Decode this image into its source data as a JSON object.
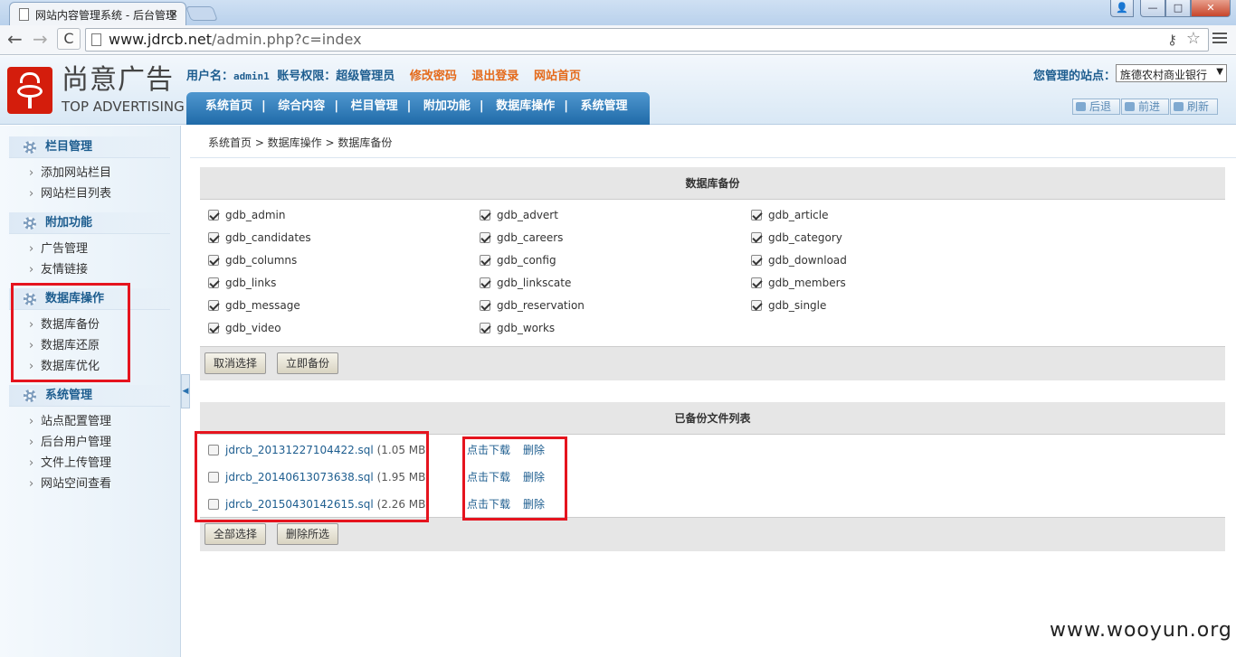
{
  "browser": {
    "tab_title": "网站内容管理系统 - 后台管理",
    "tab_close": "×",
    "url_host": "www.jdrcb.net",
    "url_path": "/admin.php?c=index",
    "win_user": "👤",
    "win_min": "—",
    "win_max": "□",
    "win_close": "✕",
    "back": "←",
    "forward": "→",
    "reload": "C",
    "key_icon": "⚷",
    "star": "☆"
  },
  "header": {
    "logo_cn": "尚意广告",
    "logo_en": "TOP ADVERTISING",
    "username_label": "用户名：",
    "username": "admin1",
    "role": "账号权限：超级管理员",
    "change_pwd": "修改密码",
    "logout": "退出登录",
    "site_home": "网站首页",
    "site_label": "您管理的站点：",
    "site_value": "旌德农村商业银行",
    "select_arrow": "▼",
    "nav": [
      "系统首页",
      "综合内容",
      "栏目管理",
      "附加功能",
      "数据库操作",
      "系统管理"
    ],
    "nav_sep": "|",
    "history": [
      "后退",
      "前进",
      "刷新"
    ]
  },
  "sidebar": {
    "groups": [
      {
        "title": "栏目管理",
        "items": [
          "添加网站栏目",
          "网站栏目列表"
        ]
      },
      {
        "title": "附加功能",
        "items": [
          "广告管理",
          "友情链接"
        ]
      },
      {
        "title": "数据库操作",
        "items": [
          "数据库备份",
          "数据库还原",
          "数据库优化"
        ]
      },
      {
        "title": "系统管理",
        "items": [
          "站点配置管理",
          "后台用户管理",
          "文件上传管理",
          "网站空间查看"
        ]
      }
    ],
    "collapse_glyph": "◀"
  },
  "breadcrumb": "系统首页 > 数据库操作 > 数据库备份",
  "backup": {
    "title": "数据库备份",
    "tables": [
      "gdb_admin",
      "gdb_advert",
      "gdb_article",
      "gdb_candidates",
      "gdb_careers",
      "gdb_category",
      "gdb_columns",
      "gdb_config",
      "gdb_download",
      "gdb_links",
      "gdb_linkscate",
      "gdb_members",
      "gdb_message",
      "gdb_reservation",
      "gdb_single",
      "gdb_video",
      "gdb_works"
    ],
    "btn_cancel": "取消选择",
    "btn_backup": "立即备份"
  },
  "files": {
    "title": "已备份文件列表",
    "list": [
      {
        "name": "jdrcb_20131227104422.sql",
        "size": "(1.05 MB)"
      },
      {
        "name": "jdrcb_20140613073638.sql",
        "size": "(1.95 MB)"
      },
      {
        "name": "jdrcb_20150430142615.sql",
        "size": "(2.26 MB)"
      }
    ],
    "download": "点击下载",
    "delete": "删除",
    "btn_select_all": "全部选择",
    "btn_delete_selected": "删除所选"
  },
  "watermark": "www.wooyun.org",
  "colors": {
    "highlight_box": "#e5141e",
    "nav_blue": "#1f6aa8",
    "link": "#1d5d8f",
    "orange_link": "#e46a1b"
  }
}
